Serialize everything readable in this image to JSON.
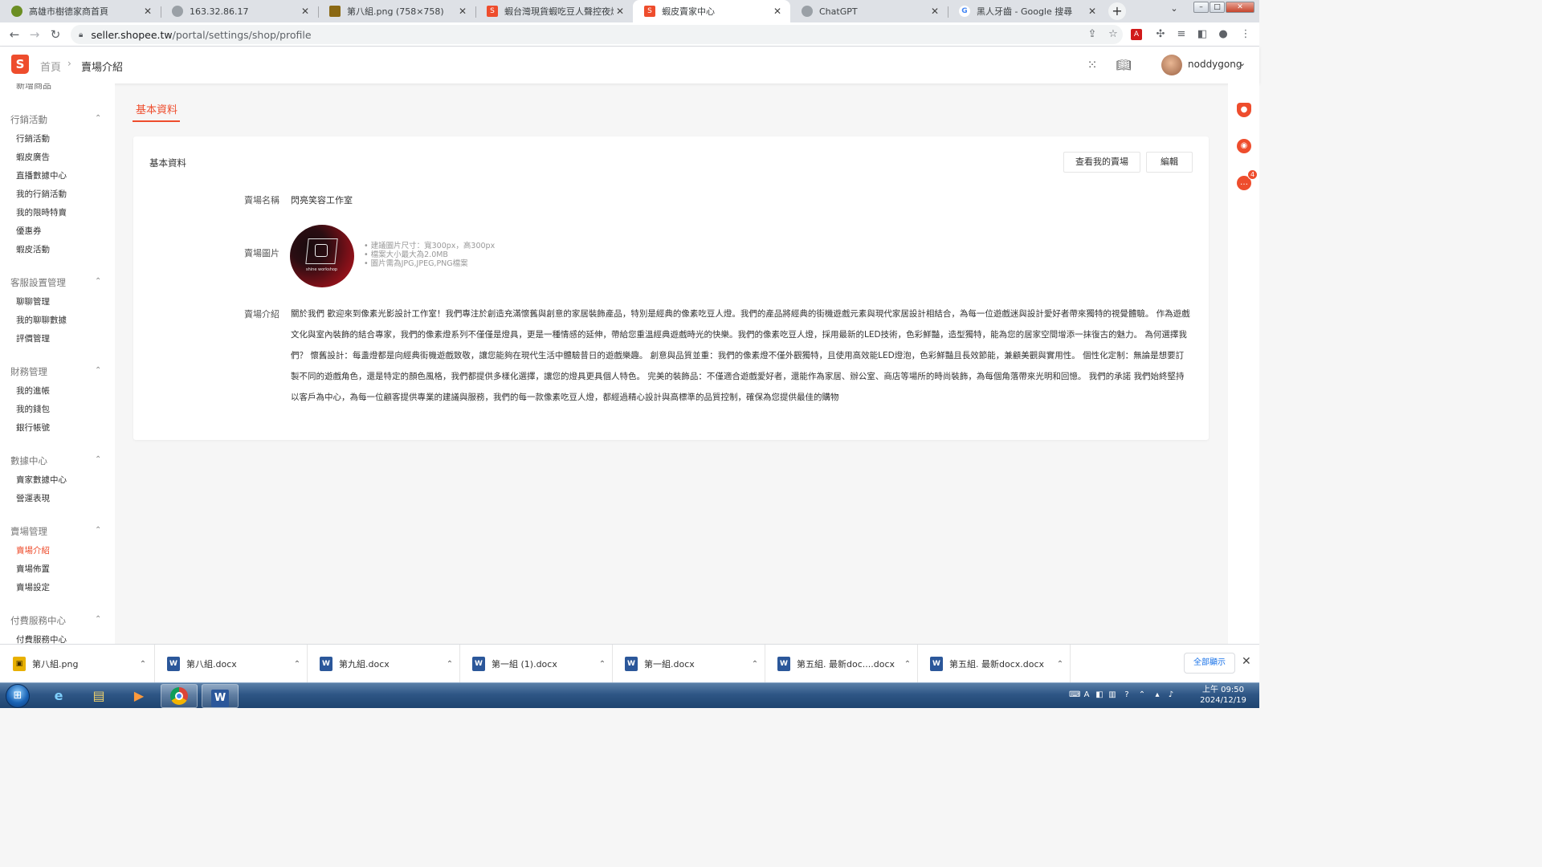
{
  "browser": {
    "tabs": [
      {
        "label": "高雄市樹德家商首頁",
        "favicon_color": "#6b8e23",
        "active": false
      },
      {
        "label": "163.32.86.17",
        "favicon_color": "#5f6368",
        "active": false
      },
      {
        "label": "第八組.png (758×758)",
        "favicon_color": "#8b6914",
        "active": false
      },
      {
        "label": "蝦台灣現貨蝦吃豆人聲控夜燈 小米",
        "favicon_color": "#ee4d2d",
        "active": false
      },
      {
        "label": "蝦皮賣家中心",
        "favicon_color": "#ee4d2d",
        "active": true
      },
      {
        "label": "ChatGPT",
        "favicon_color": "#5f6368",
        "active": false
      },
      {
        "label": "黑人牙齒 - Google 搜尋",
        "favicon_color": "#4285f4",
        "active": false
      }
    ],
    "new_tab_label": "+",
    "url_host": "seller.shopee.tw",
    "url_path": "/portal/settings/shop/profile"
  },
  "header": {
    "breadcrumb_home": "首頁",
    "breadcrumb_sep": "›",
    "breadcrumb_current": "賣場介紹",
    "username": "noddygong"
  },
  "sidebar": {
    "cut_item": "新增商品",
    "groups": [
      {
        "title": "行銷活動",
        "items": [
          "行銷活動",
          "蝦皮廣告",
          "直播數據中心",
          "我的行銷活動",
          "我的限時特賣",
          "優惠券",
          "蝦皮活動"
        ]
      },
      {
        "title": "客服設置管理",
        "items": [
          "聊聊管理",
          "我的聊聊數據",
          "評價管理"
        ]
      },
      {
        "title": "財務管理",
        "items": [
          "我的進帳",
          "我的錢包",
          "銀行帳號"
        ]
      },
      {
        "title": "數據中心",
        "items": [
          "賣家數據中心",
          "營運表現"
        ]
      },
      {
        "title": "賣場管理",
        "items": [
          "賣場介紹",
          "賣場佈置",
          "賣場設定"
        ]
      },
      {
        "title": "付費服務中心",
        "items": [
          "付費服務中心"
        ]
      }
    ],
    "active_item": "賣場介紹"
  },
  "main": {
    "tab_label": "基本資料",
    "card_title": "基本資料",
    "view_shop_button": "查看我的賣場",
    "edit_button": "編輯",
    "shop_name_label": "賣場名稱",
    "shop_name": "閃亮笑容工作室",
    "shop_image_label": "賣場圖片",
    "logo_caption": "shine workshop",
    "image_hints": [
      "建議圖片尺寸：寬300px，高300px",
      "檔案大小最大為2.0MB",
      "圖片需為JPG,JPEG,PNG檔案"
    ],
    "description_label": "賣場介紹",
    "description": "關於我們 歡迎來到像素光影設計工作室！我們專注於創造充滿懷舊與創意的家居裝飾產品，特別是經典的像素吃豆人燈。我們的產品將經典的街機遊戲元素與現代家居設計相結合，為每一位遊戲迷與設計愛好者帶來獨特的視覺體驗。 作為遊戲文化與室內裝飾的結合專家，我們的像素燈系列不僅僅是燈具，更是一種情感的延伸，帶給您重溫經典遊戲時光的快樂。我們的像素吃豆人燈，採用最新的LED技術，色彩鮮豔，造型獨特，能為您的居家空間增添一抹復古的魅力。 為何選擇我們？ 懷舊設計：每盞燈都是向經典街機遊戲致敬，讓您能夠在現代生活中體驗昔日的遊戲樂趣。 創意與品質並重：我們的像素燈不僅外觀獨特，且使用高效能LED燈泡，色彩鮮豔且長效節能，兼顧美觀與實用性。 個性化定制：無論是想要訂製不同的遊戲角色，還是特定的顏色風格，我們都提供多樣化選擇，讓您的燈具更具個人特色。 完美的裝飾品：不僅適合遊戲愛好者，還能作為家居、辦公室、商店等場所的時尚裝飾，為每個角落帶來光明和回憶。 我們的承諾 我們始終堅持以客戶為中心，為每一位顧客提供專業的建議與服務，我們的每一款像素吃豆人燈，都經過精心設計與高標準的品質控制，確保為您提供最佳的購物"
  },
  "rightbar": {
    "chat_badge": "4"
  },
  "downloads": {
    "items": [
      {
        "name": "第八組.png",
        "type": "png"
      },
      {
        "name": "第八組.docx",
        "type": "docx"
      },
      {
        "name": "第九組.docx",
        "type": "docx"
      },
      {
        "name": "第一組 (1).docx",
        "type": "docx"
      },
      {
        "name": "第一組.docx",
        "type": "docx"
      },
      {
        "name": "第五組. 最新doc....docx",
        "type": "docx"
      },
      {
        "name": "第五組. 最新docx.docx",
        "type": "docx"
      }
    ],
    "show_all": "全部顯示"
  },
  "taskbar": {
    "time": "上午 09:50",
    "date": "2024/12/19"
  },
  "colors": {
    "accent": "#ee4d2d",
    "word_blue": "#2b579a"
  }
}
